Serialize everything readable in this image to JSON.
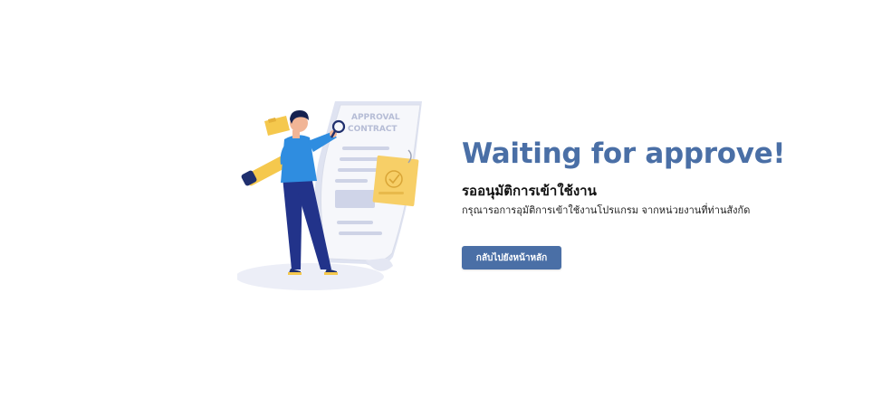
{
  "illustration": {
    "title_line_1": "APPROVAL",
    "title_line_2": "CONTRACT"
  },
  "content": {
    "headline": "Waiting for approve!",
    "subheading": "รออนุมัติการเข้าใช้งาน",
    "description": "กรุณารอการอุมัติการเข้าใช้งานโปรแกรม จากหน่วยงานที่ท่านสังกัด",
    "button_label": "กลับไปยังหน้าหลัก"
  },
  "colors": {
    "accent": "#4a6fa6",
    "background": "#ffffff",
    "heading_text": "#111111"
  }
}
